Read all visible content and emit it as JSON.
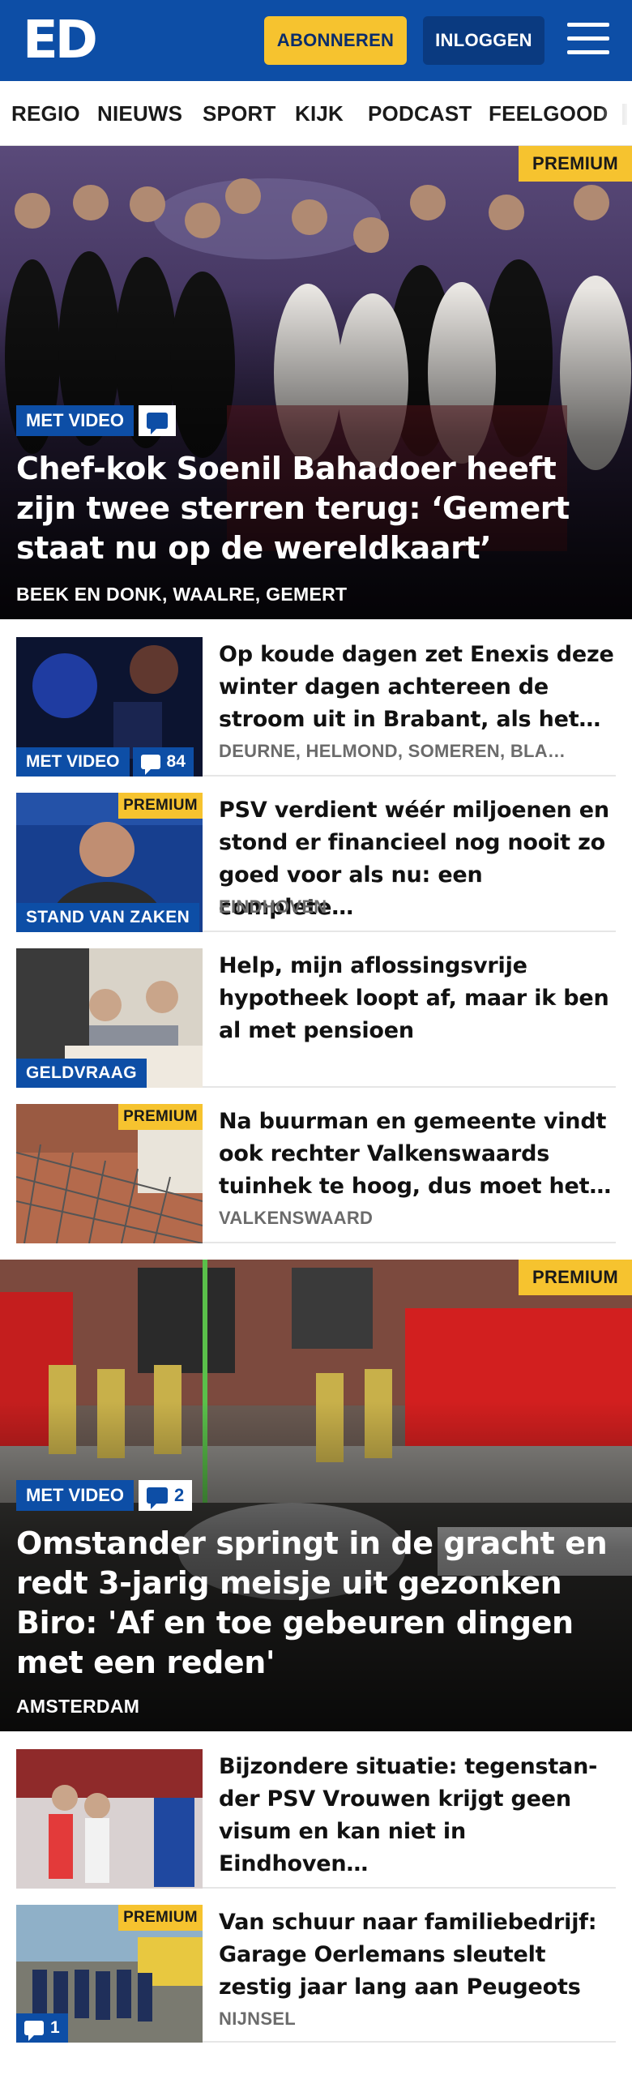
{
  "header": {
    "logo": "ED",
    "subscribe_label": "ABONNEREN",
    "login_label": "INLOGGEN"
  },
  "nav": {
    "items": [
      "REGIO",
      "NIEUWS",
      "SPORT",
      "KIJK",
      "PODCAST",
      "FEELGOOD"
    ]
  },
  "hero1": {
    "premium": "PREMIUM",
    "video_label": "MET VIDEO",
    "title": "Chef-kok Soenil Bahadoer heeft zijn twee sterren terug: ‘Gemert staat nu op de wereldkaart’",
    "location": "BEEK EN DONK, WAALRE, GEMERT"
  },
  "articles1": [
    {
      "title": "Op koude dagen zet Enexis deze winter dagen achtereen de stroom uit in Brabant, als het…",
      "location": "DEURNE, HELMOND, SOMEREN, BLA…",
      "label": "MET VIDEO",
      "comments": "84"
    },
    {
      "title": "PSV verdient wéér miljoenen en stond er financieel nog nooit zo goed voor als nu: een complete…",
      "location": "EINDHOVEN",
      "label": "STAND VAN ZAKEN",
      "premium": "PREMIUM"
    },
    {
      "title": "Help, mijn aflossingsvrije hypotheek loopt af, maar ik ben al met pensioen",
      "label": "GELDVRAAG"
    },
    {
      "title": "Na buurman en gemeente vindt ook rechter Valkenswaards tuinhek te hoog, dus moet het…",
      "location": "VALKENSWAARD",
      "premium": "PREMIUM"
    }
  ],
  "hero2": {
    "premium": "PREMIUM",
    "video_label": "MET VIDEO",
    "comments": "2",
    "title": "Omstander springt in de gracht en redt 3-jarig meisje uit gezonken Biro: 'Af en toe gebeuren dingen met een reden'",
    "location": "AMSTERDAM"
  },
  "articles2": [
    {
      "title": "Bijzondere situatie: tegenstan-der PSV Vrouwen krijgt geen visum en kan niet in Eindhoven…"
    },
    {
      "title": "Van schuur naar familiebedrijf: Garage Oerlemans sleutelt zestig jaar lang aan Peugeots",
      "location": "NIJNSEL",
      "premium": "PREMIUM",
      "comments": "1"
    }
  ],
  "colors": {
    "brand_blue": "#0d4ea6",
    "premium_yellow": "#f6c32f",
    "location_grey": "#6b6b6b"
  }
}
